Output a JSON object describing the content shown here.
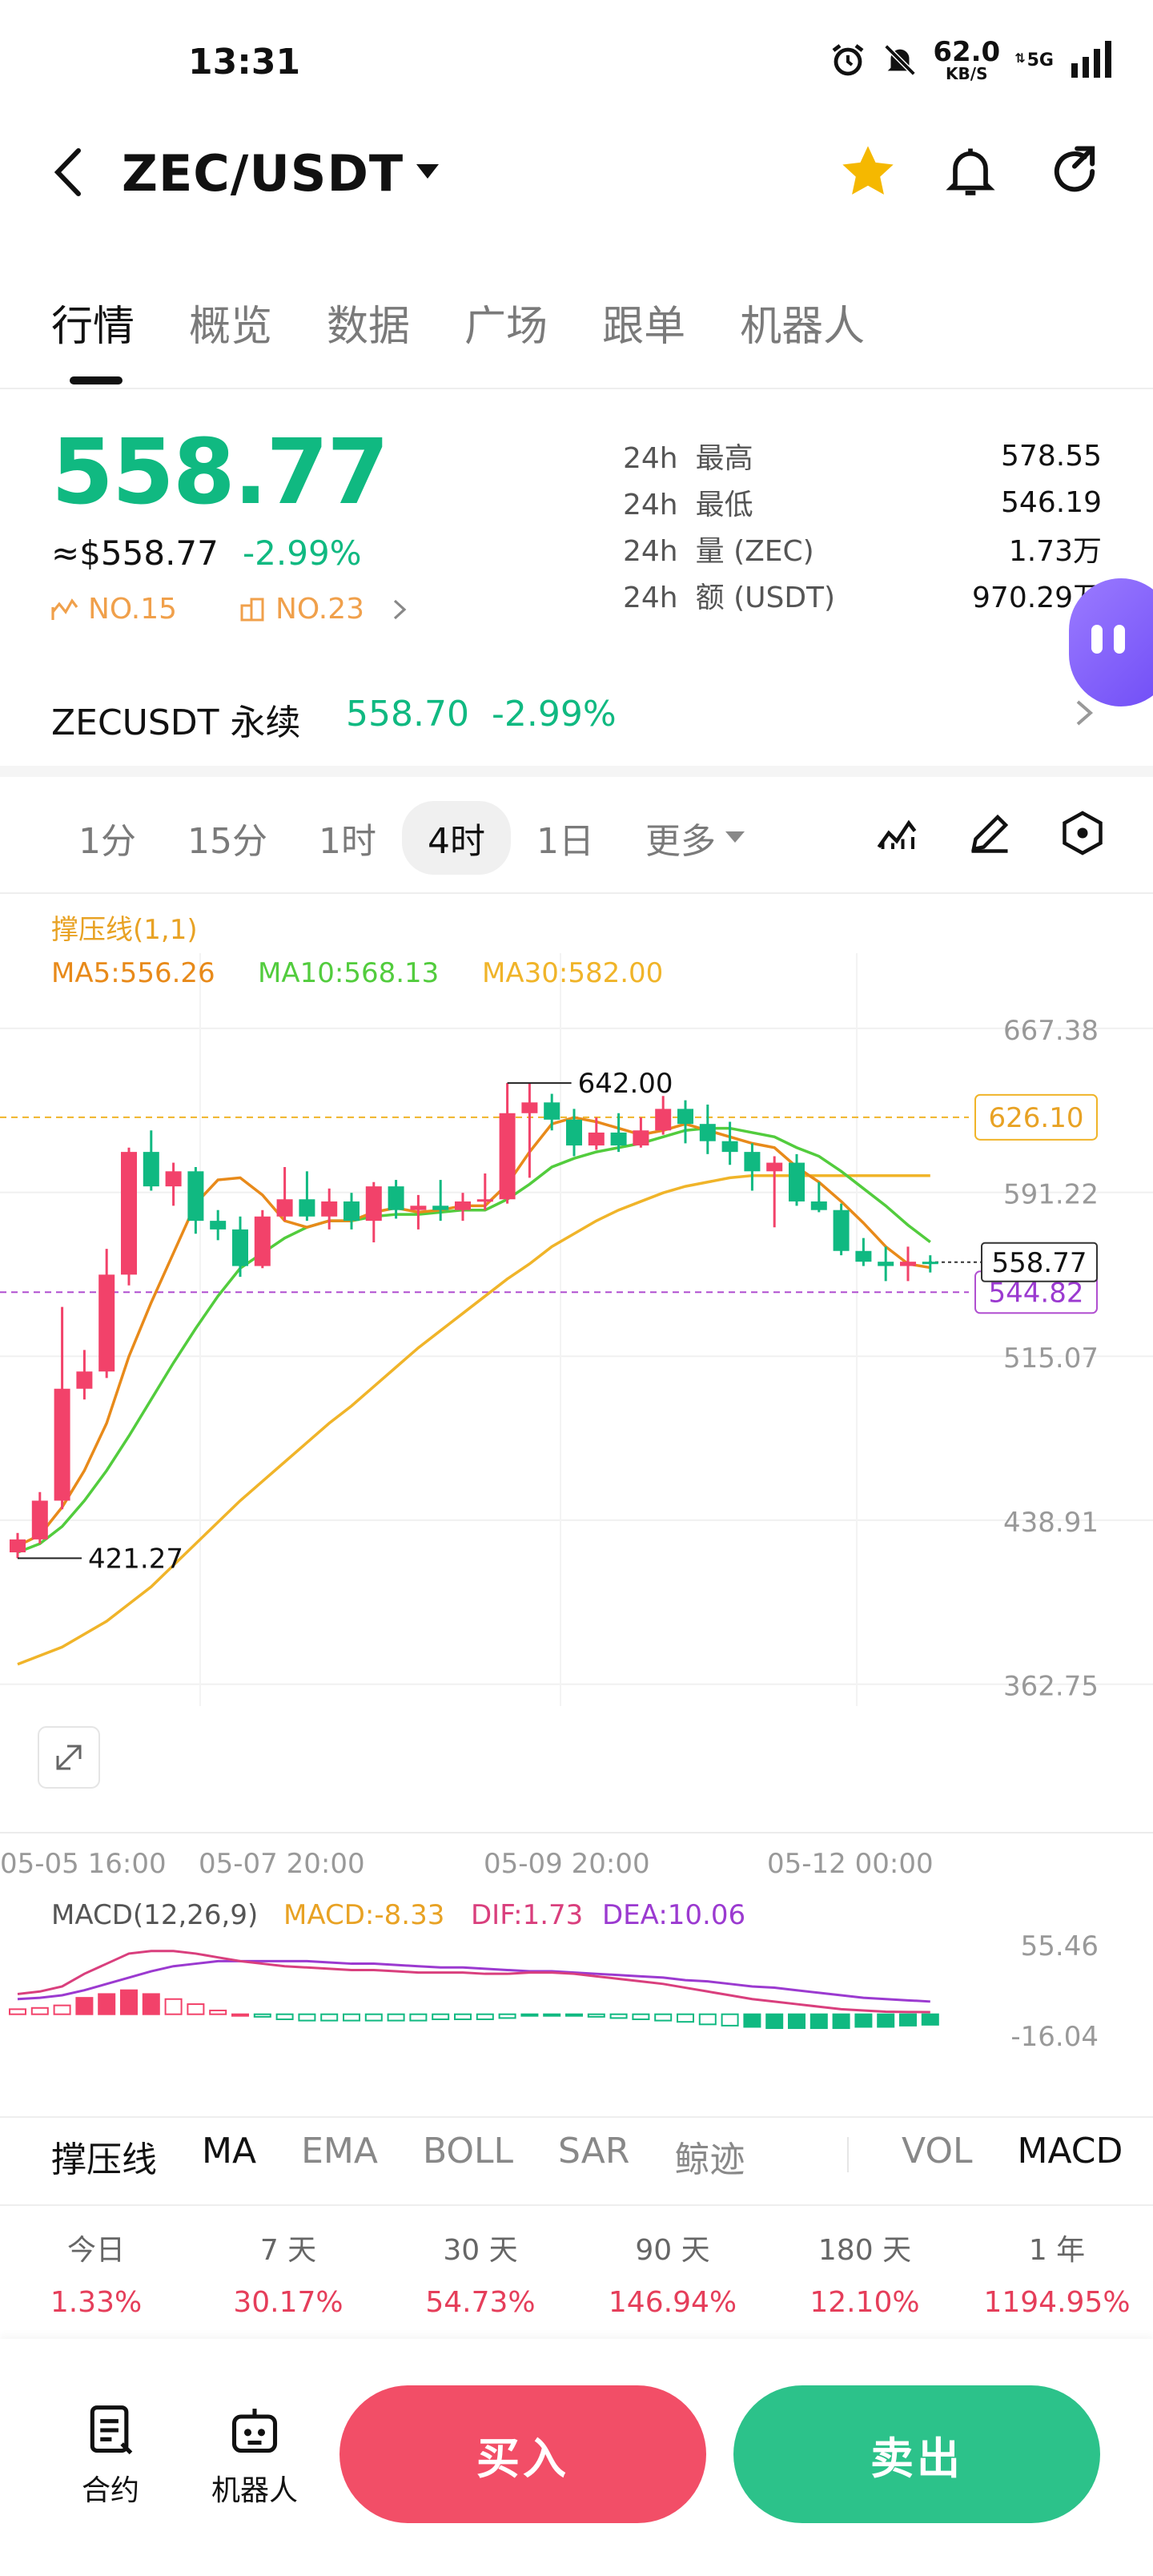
{
  "status_bar": {
    "time": "13:31",
    "net_speed": "62.0",
    "net_unit": "KB/S",
    "network": "5G"
  },
  "header": {
    "pair": "ZEC/USDT"
  },
  "tabs": [
    {
      "label": "行情",
      "active": true
    },
    {
      "label": "概览",
      "active": false
    },
    {
      "label": "数据",
      "active": false
    },
    {
      "label": "广场",
      "active": false
    },
    {
      "label": "跟单",
      "active": false
    },
    {
      "label": "机器人",
      "active": false
    }
  ],
  "price": {
    "last": "558.77",
    "usd": "≈$558.77",
    "change": "-2.99%",
    "rank1": "NO.15",
    "rank2": "NO.23"
  },
  "stats": [
    {
      "period": "24h",
      "label": "最高",
      "value": "578.55"
    },
    {
      "period": "24h",
      "label": "最低",
      "value": "546.19"
    },
    {
      "period": "24h",
      "label": "量 (ZEC)",
      "value": "1.73万"
    },
    {
      "period": "24h",
      "label": "额 (USDT)",
      "value": "970.29万"
    }
  ],
  "perp": {
    "name": "ZECUSDT 永续",
    "price": "558.70",
    "change": "-2.99%"
  },
  "intervals": [
    {
      "label": "1分",
      "active": false
    },
    {
      "label": "15分",
      "active": false
    },
    {
      "label": "1时",
      "active": false
    },
    {
      "label": "4时",
      "active": true
    },
    {
      "label": "1日",
      "active": false
    }
  ],
  "more_label": "更多",
  "chart_data": {
    "type": "candlestick",
    "overlay_title": "撑压线(1,1)",
    "ma_labels": {
      "ma5": "MA5:556.26",
      "ma10": "MA10:568.13",
      "ma30": "MA30:582.00"
    },
    "y_ticks": [
      "667.38",
      "591.22",
      "515.07",
      "438.91",
      "362.75"
    ],
    "y_tick_values": [
      667.38,
      591.22,
      515.07,
      438.91,
      362.75
    ],
    "x_ticks": [
      "05-05 16:00",
      "05-07 20:00",
      "05-09 20:00",
      "05-12 00:00"
    ],
    "high_label": "642.00",
    "low_label": "421.27",
    "resistance": {
      "label": "626.10",
      "value": 626.1
    },
    "support": {
      "label": "544.82",
      "value": 544.82
    },
    "current": {
      "label": "558.77",
      "value": 558.77
    },
    "candles": [
      [
        424,
        430,
        421.27,
        433
      ],
      [
        430,
        448,
        428,
        452
      ],
      [
        448,
        500,
        444,
        538
      ],
      [
        500,
        508,
        495,
        518
      ],
      [
        508,
        553,
        505,
        565
      ],
      [
        553,
        610,
        548,
        612
      ],
      [
        610,
        594,
        592,
        620
      ],
      [
        594,
        601,
        585,
        605
      ],
      [
        601,
        578,
        572,
        603
      ],
      [
        578,
        574,
        569,
        583
      ],
      [
        574,
        557,
        552,
        580
      ],
      [
        557,
        580,
        556,
        583
      ],
      [
        580,
        588,
        578,
        603
      ],
      [
        588,
        580,
        578,
        601
      ],
      [
        580,
        587,
        574,
        593
      ],
      [
        587,
        578,
        574,
        591
      ],
      [
        578,
        594,
        568,
        596
      ],
      [
        594,
        583,
        579,
        597
      ],
      [
        583,
        585,
        574,
        590
      ],
      [
        585,
        583,
        578,
        597
      ],
      [
        583,
        587,
        578,
        591
      ],
      [
        587,
        588,
        583,
        600
      ],
      [
        588,
        628,
        586,
        642
      ],
      [
        628,
        633,
        598,
        642
      ],
      [
        633,
        625,
        620,
        637
      ],
      [
        625,
        613,
        608,
        630
      ],
      [
        613,
        619,
        611,
        626
      ],
      [
        619,
        613,
        610,
        628
      ],
      [
        613,
        620,
        612,
        626
      ],
      [
        620,
        630,
        618,
        636
      ],
      [
        630,
        623,
        614,
        634
      ],
      [
        623,
        615,
        609,
        632
      ],
      [
        615,
        610,
        604,
        624
      ],
      [
        610,
        601,
        592,
        614
      ],
      [
        601,
        605,
        575,
        608
      ],
      [
        605,
        587,
        585,
        609
      ],
      [
        587,
        583,
        582,
        596
      ],
      [
        583,
        564,
        562,
        586
      ],
      [
        564,
        559,
        557,
        570
      ],
      [
        559,
        557,
        550,
        566
      ],
      [
        557,
        559,
        550,
        566
      ],
      [
        559,
        558.77,
        554,
        562
      ]
    ],
    "ma5": [
      427,
      432,
      445,
      462,
      484,
      515,
      540,
      563,
      586,
      597,
      598,
      590,
      578,
      575,
      578,
      578,
      582,
      584,
      582,
      583,
      585,
      585,
      595,
      610,
      623,
      626,
      624,
      621,
      618,
      620,
      623,
      620,
      617,
      614,
      612,
      603,
      596,
      587,
      577,
      566,
      558,
      556.26
    ],
    "ma10": [
      424,
      428,
      436,
      448,
      462,
      478,
      495,
      512,
      528,
      543,
      556,
      563,
      570,
      575,
      578,
      578,
      580,
      581,
      581,
      582,
      583,
      583,
      588,
      595,
      603,
      607,
      610,
      612,
      614,
      617,
      620,
      621,
      621,
      619,
      617,
      612,
      608,
      601,
      593,
      585,
      576,
      568.13
    ],
    "ma30": [
      372,
      376,
      380,
      386,
      392,
      400,
      408,
      418,
      428,
      438,
      448,
      457,
      466,
      475,
      484,
      492,
      501,
      510,
      519,
      527,
      535,
      543,
      551,
      558,
      566,
      572,
      578,
      583,
      587,
      591,
      594,
      596,
      598,
      599,
      599,
      599,
      599,
      599,
      599,
      599,
      599,
      599
    ],
    "macd_panel": {
      "title": "MACD(12,26,9)",
      "macd_label": "MACD:-8.33",
      "dif_label": "DIF:1.73",
      "dea_label": "DEA:10.06",
      "y_ticks": [
        "55.46",
        "-16.04"
      ],
      "y_tick_values": [
        55.46,
        -16.04
      ],
      "dif": [
        16,
        18,
        22,
        32,
        40,
        48,
        50,
        50,
        48,
        45,
        42,
        40,
        38,
        37,
        36,
        35,
        35,
        34,
        33,
        33,
        33,
        32,
        32,
        33,
        33,
        32,
        30,
        28,
        26,
        24,
        21,
        18,
        15,
        12,
        10,
        8,
        6,
        4,
        3,
        2,
        1.8,
        1.73
      ],
      "dea": [
        12,
        13,
        15,
        19,
        24,
        29,
        34,
        38,
        40,
        42,
        42,
        42,
        42,
        42,
        41,
        40,
        40,
        39,
        38,
        37,
        37,
        36,
        35,
        34,
        34,
        33,
        32,
        31,
        30,
        29,
        27,
        26,
        24,
        22,
        21,
        19,
        17,
        15,
        13,
        12,
        11,
        10.06
      ],
      "hist": [
        4,
        5,
        7,
        13,
        16,
        19,
        16,
        12,
        8,
        3,
        0,
        -2,
        -4,
        -5,
        -5,
        -5,
        -5,
        -5,
        -5,
        -4,
        -4,
        -4,
        -3,
        -1,
        -1,
        -1,
        -2,
        -3,
        -4,
        -5,
        -6,
        -8,
        -9,
        -10,
        -11,
        -11,
        -11,
        -11,
        -10,
        -10,
        -9,
        -8.33
      ]
    }
  },
  "indicators_main": [
    {
      "label": "撑压线",
      "active": true
    },
    {
      "label": "MA",
      "active": true
    },
    {
      "label": "EMA",
      "active": false
    },
    {
      "label": "BOLL",
      "active": false
    },
    {
      "label": "SAR",
      "active": false
    },
    {
      "label": "鲸迹",
      "active": false
    }
  ],
  "indicators_sub": [
    {
      "label": "VOL",
      "active": false
    },
    {
      "label": "MACD",
      "active": true
    }
  ],
  "performance": [
    {
      "period": "今日",
      "value": "1.33%"
    },
    {
      "period": "7 天",
      "value": "30.17%"
    },
    {
      "period": "30 天",
      "value": "54.73%"
    },
    {
      "period": "90 天",
      "value": "146.94%"
    },
    {
      "period": "180 天",
      "value": "12.10%"
    },
    {
      "period": "1 年",
      "value": "1194.95%"
    }
  ],
  "bottom_bar": {
    "contract": "合约",
    "robot": "机器人",
    "buy": "买入",
    "sell": "卖出"
  },
  "colors": {
    "up": "#f2426a",
    "down": "#10b981",
    "ma5": "#e88a1a",
    "ma10": "#52cc3d",
    "ma30": "#f0b429",
    "dif": "#d93f7d",
    "dea": "#9b3ad0"
  }
}
